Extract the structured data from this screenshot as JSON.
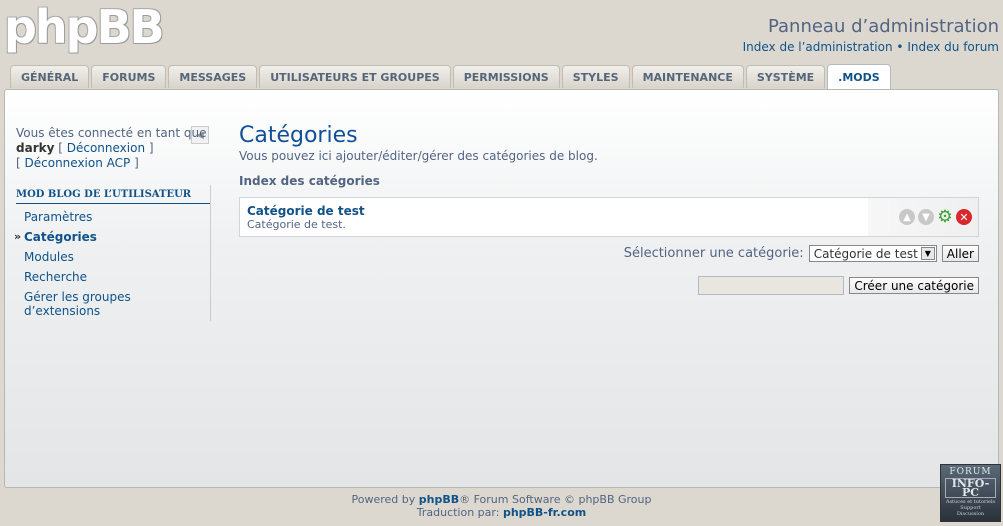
{
  "header": {
    "logo": "phpBB",
    "panel_title": "Panneau d’administration",
    "link_admin_index": "Index de l’administration",
    "separator": " • ",
    "link_forum_index": "Index du forum"
  },
  "tabs": [
    {
      "label": "GÉNÉRAL"
    },
    {
      "label": "FORUMS"
    },
    {
      "label": "MESSAGES"
    },
    {
      "label": "UTILISATEURS ET GROUPES"
    },
    {
      "label": "PERMISSIONS"
    },
    {
      "label": "STYLES"
    },
    {
      "label": "MAINTENANCE"
    },
    {
      "label": "SYSTÈME"
    },
    {
      "label": ".MODS"
    }
  ],
  "active_tab": ".MODS",
  "sidebar": {
    "login_prefix": "Vous êtes connecté en tant que",
    "username": "darky",
    "logout": "Déconnexion",
    "logout_acp": "Déconnexion ACP",
    "section_title": "MOD BLOG DE L’UTILISATEUR",
    "items": [
      {
        "label": "Paramètres"
      },
      {
        "label": "Catégories"
      },
      {
        "label": "Modules"
      },
      {
        "label": "Recherche"
      },
      {
        "label": "Gérer les groupes d’extensions"
      }
    ],
    "active_item": "Catégories"
  },
  "main": {
    "title": "Catégories",
    "description": "Vous pouvez ici ajouter/éditer/gérer des catégories de blog.",
    "index_title": "Index des catégories",
    "categories": [
      {
        "name": "Catégorie de test",
        "description": "Catégorie de test."
      }
    ],
    "select_label": "Sélectionner une catégorie:",
    "select_value": "Catégorie de test",
    "go_button": "Aller",
    "create_input_value": "",
    "create_button": "Créer une catégorie"
  },
  "footer": {
    "line1_prefix": "Powered by ",
    "line1_brand": "phpBB",
    "line1_suffix": "® Forum Software © phpBB Group",
    "line2_prefix": "Traduction par: ",
    "line2_brand": "phpBB-fr.com"
  },
  "badge": {
    "line1": "FORUM",
    "line2": "INFO-PC",
    "line3": "Astuces et tutoriels",
    "line4": "Support",
    "line5": "Discussion"
  },
  "colors": {
    "link": "#105289",
    "title": "#115098",
    "text": "#536482",
    "background": "#dcd8cf",
    "delete": "#d9272e",
    "gear": "#3aa033"
  },
  "icons": [
    "menu-collapse-icon",
    "move-up-icon",
    "move-down-icon",
    "gear-icon",
    "delete-icon",
    "select-arrow-icon"
  ]
}
